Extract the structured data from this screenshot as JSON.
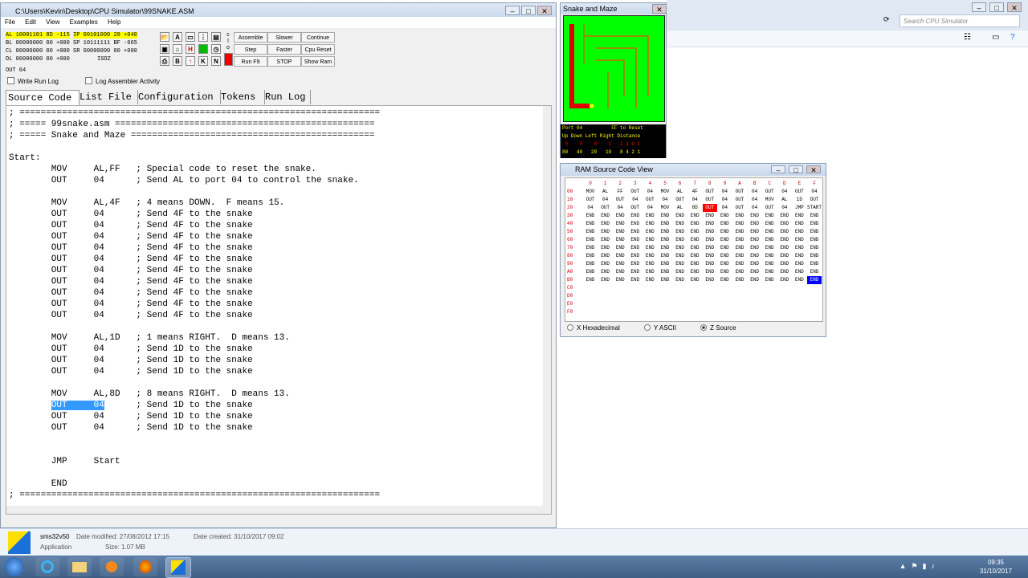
{
  "explorer": {
    "search_placeholder": "Search CPU Simulator"
  },
  "simulator": {
    "title": "C:\\Users\\Kevin\\Desktop\\CPU Simulator\\99SNAKE.ASM",
    "menu": [
      "File",
      "Edit",
      "View",
      "Examples",
      "Help"
    ],
    "registers": [
      "AL 10001101 8D -115",
      "IP 00101000 28 +040",
      "BL 00000000 00 +000",
      "SP 10111111 BF -065",
      "CL 00000000 00 +000",
      "SR 00000000 00 +000",
      "DL 00000000 00 +000",
      "ISOZ"
    ],
    "instruction": "OUT      04",
    "tool_letters": [
      "A",
      "H",
      "I",
      "B",
      "K",
      "N"
    ],
    "buttons": {
      "assemble": "Assemble",
      "slower": "Slower",
      "continue": "Continue",
      "step": "Step",
      "faster": "Faster",
      "cpu_reset": "Cpu Reset",
      "run": "Run F9",
      "stop": "STOP",
      "show_ram": "Show Ram"
    },
    "checkboxes": {
      "write_run_log": "Write Run Log",
      "log_assembler": "Log Assembler Activity"
    },
    "tabs": [
      "Source Code",
      "List File",
      "Configuration",
      "Tokens",
      "Run Log"
    ],
    "code_lines": [
      "; ====================================================================",
      "; ===== 99snake.asm =================================================",
      "; ===== Snake and Maze ==============================================",
      "",
      "Start:",
      "        MOV     AL,FF   ; Special code to reset the snake.",
      "        OUT     04      ; Send AL to port 04 to control the snake.",
      "",
      "        MOV     AL,4F   ; 4 means DOWN.  F means 15.",
      "        OUT     04      ; Send 4F to the snake",
      "        OUT     04      ; Send 4F to the snake",
      "        OUT     04      ; Send 4F to the snake",
      "        OUT     04      ; Send 4F to the snake",
      "        OUT     04      ; Send 4F to the snake",
      "        OUT     04      ; Send 4F to the snake",
      "        OUT     04      ; Send 4F to the snake",
      "        OUT     04      ; Send 4F to the snake",
      "        OUT     04      ; Send 4F to the snake",
      "        OUT     04      ; Send 4F to the snake",
      "",
      "        MOV     AL,1D   ; 1 means RIGHT.  D means 13.",
      "        OUT     04      ; Send 1D to the snake",
      "        OUT     04      ; Send 1D to the snake",
      "        OUT     04      ; Send 1D to the snake",
      "",
      "        MOV     AL,8D   ; 8 means RIGHT.  D means 13.",
      "        OUT     04      ; Send 1D to the snake",
      "        OUT     04      ; Send 1D to the snake",
      "        OUT     04      ; Send 1D to the snake",
      "",
      "",
      "        JMP     Start",
      "",
      "        END",
      "; ===================================================================="
    ],
    "selected_line": 26,
    "selected_text": "OUT     04"
  },
  "snake": {
    "title": "Snake and Maze",
    "info_lines": [
      "Port 04          FF to Reset",
      "Up Down Left Right Distance",
      " 0    0    0    1   1 1 0 1",
      "80   40   20   10   8 4 2 1"
    ]
  },
  "ram": {
    "title": "RAM Source Code View",
    "header": [
      "0",
      "1",
      "2",
      "3",
      "4",
      "5",
      "6",
      "7",
      "8",
      "9",
      "A",
      "B",
      "C",
      "D",
      "E",
      "F"
    ],
    "rows": [
      {
        "addr": "00",
        "cells": [
          "MOV",
          "AL",
          "FF",
          "OUT",
          "04",
          "MOV",
          "AL",
          "4F",
          "OUT",
          "04",
          "OUT",
          "04",
          "OUT",
          "04",
          "OUT",
          "04"
        ]
      },
      {
        "addr": "10",
        "cells": [
          "OUT",
          "04",
          "OUT",
          "04",
          "OUT",
          "04",
          "OUT",
          "04",
          "OUT",
          "04",
          "OUT",
          "04",
          "MOV",
          "AL",
          "1D",
          "OUT"
        ]
      },
      {
        "addr": "20",
        "cells": [
          "04",
          "OUT",
          "04",
          "OUT",
          "04",
          "MOV",
          "AL",
          "8D",
          "OUT",
          "04",
          "OUT",
          "04",
          "OUT",
          "04",
          "JMP",
          "START"
        ]
      },
      {
        "addr": "30",
        "cells": [
          "END",
          "END",
          "END",
          "END",
          "END",
          "END",
          "END",
          "END",
          "END",
          "END",
          "END",
          "END",
          "END",
          "END",
          "END",
          "END"
        ]
      },
      {
        "addr": "40",
        "cells": [
          "END",
          "END",
          "END",
          "END",
          "END",
          "END",
          "END",
          "END",
          "END",
          "END",
          "END",
          "END",
          "END",
          "END",
          "END",
          "END"
        ]
      },
      {
        "addr": "50",
        "cells": [
          "END",
          "END",
          "END",
          "END",
          "END",
          "END",
          "END",
          "END",
          "END",
          "END",
          "END",
          "END",
          "END",
          "END",
          "END",
          "END"
        ]
      },
      {
        "addr": "60",
        "cells": [
          "END",
          "END",
          "END",
          "END",
          "END",
          "END",
          "END",
          "END",
          "END",
          "END",
          "END",
          "END",
          "END",
          "END",
          "END",
          "END"
        ]
      },
      {
        "addr": "70",
        "cells": [
          "END",
          "END",
          "END",
          "END",
          "END",
          "END",
          "END",
          "END",
          "END",
          "END",
          "END",
          "END",
          "END",
          "END",
          "END",
          "END"
        ]
      },
      {
        "addr": "80",
        "cells": [
          "END",
          "END",
          "END",
          "END",
          "END",
          "END",
          "END",
          "END",
          "END",
          "END",
          "END",
          "END",
          "END",
          "END",
          "END",
          "END"
        ]
      },
      {
        "addr": "90",
        "cells": [
          "END",
          "END",
          "END",
          "END",
          "END",
          "END",
          "END",
          "END",
          "END",
          "END",
          "END",
          "END",
          "END",
          "END",
          "END",
          "END"
        ]
      },
      {
        "addr": "A0",
        "cells": [
          "END",
          "END",
          "END",
          "END",
          "END",
          "END",
          "END",
          "END",
          "END",
          "END",
          "END",
          "END",
          "END",
          "END",
          "END",
          "END"
        ]
      },
      {
        "addr": "B0",
        "cells": [
          "END",
          "END",
          "END",
          "END",
          "END",
          "END",
          "END",
          "END",
          "END",
          "END",
          "END",
          "END",
          "END",
          "END",
          "END",
          "END"
        ]
      },
      {
        "addr": "C0",
        "cells": []
      },
      {
        "addr": "D0",
        "cells": []
      },
      {
        "addr": "E0",
        "cells": []
      },
      {
        "addr": "F0",
        "cells": []
      }
    ],
    "highlight_red": "28",
    "highlight_blue": "BF",
    "radio_hex": "X  Hexadecimal",
    "radio_ascii": "Y  ASCII",
    "radio_source": "Z  Source"
  },
  "details": {
    "name": "sms32v50",
    "type": "Application",
    "modified": "Date modified: 27/08/2012 17:15",
    "size": "Size: 1.07 MB",
    "created": "Date created: 31/10/2017 09:02"
  },
  "clock": {
    "time": "09:35",
    "date": "31/10/2017"
  }
}
